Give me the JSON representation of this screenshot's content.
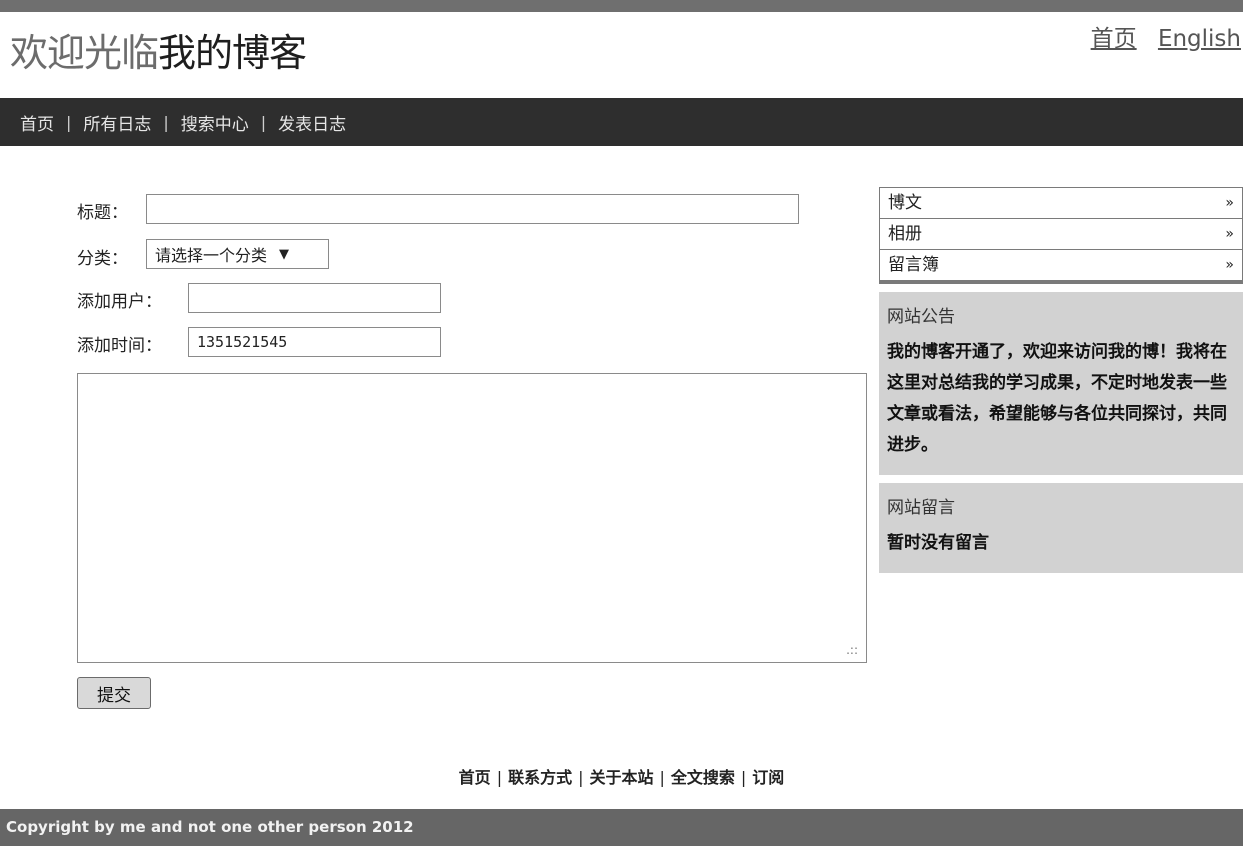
{
  "header": {
    "title_light": "欢迎光临",
    "title_dark": "我的博客",
    "links": [
      "首页",
      "English"
    ]
  },
  "nav": {
    "items": [
      "首页",
      "所有日志",
      "搜索中心",
      "发表日志"
    ],
    "separator": "|"
  },
  "form": {
    "title_label": "标题：",
    "title_value": "",
    "category_label": "分类：",
    "category_selected": "请选择一个分类",
    "user_label": "添加用户：",
    "user_value": "",
    "time_label": "添加时间：",
    "time_value": "1351521545",
    "content_value": "",
    "submit_label": "提交"
  },
  "sidebar": {
    "menu": [
      "博文",
      "相册",
      "留言簿"
    ],
    "menu_arrow": "»",
    "notice": {
      "title": "网站公告",
      "body": "我的博客开通了，欢迎来访问我的博！我将在这里对总结我的学习成果，不定时地发表一些文章或看法，希望能够与各位共同探讨，共同进步。"
    },
    "messages": {
      "title": "网站留言",
      "body": "暂时没有留言"
    }
  },
  "footer": {
    "links": [
      "首页",
      "联系方式",
      "关于本站",
      "全文搜索",
      "订阅"
    ],
    "separator": "|",
    "copyright": "Copyright by me and not one other person 2012"
  },
  "colors": {
    "navbar": "#2e2e2e",
    "sidebar_panel": "#d2d2d2",
    "copyright_bar": "#666666"
  },
  "icons": {
    "select_caret": "caret-down-icon",
    "resize_grip": "resize-grip-icon"
  }
}
